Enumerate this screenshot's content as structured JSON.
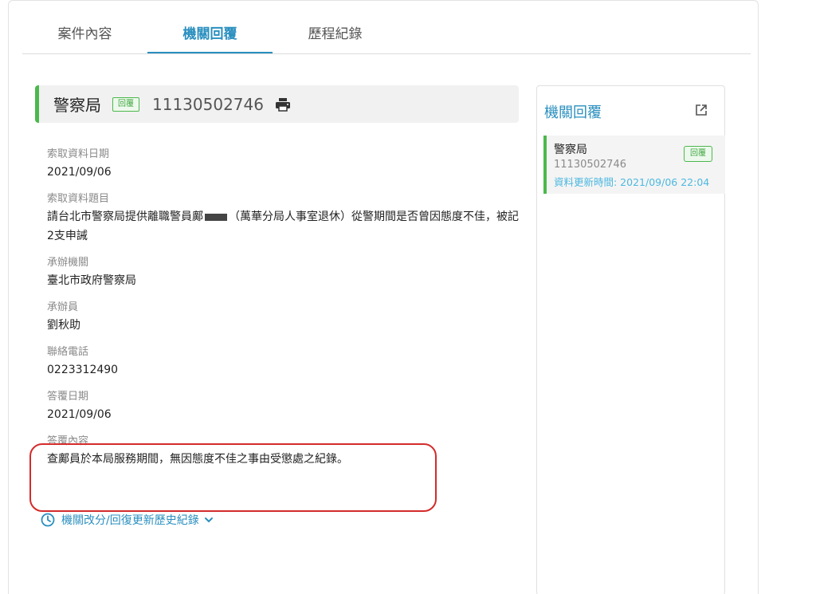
{
  "tabs": [
    {
      "label": "案件內容"
    },
    {
      "label": "機關回覆"
    },
    {
      "label": "歷程紀錄"
    }
  ],
  "active_tab": "機關回覆",
  "agency": {
    "name": "警察局",
    "badge": "回覆",
    "case_number": "11130502746",
    "print_icon": "printer-icon"
  },
  "fields": [
    {
      "label": "索取資料日期",
      "value": "2021/09/06"
    },
    {
      "label": "索取資料題目",
      "value_before": "請台北市警察局提供離職警員鄺",
      "value_after": "（萬華分局人事室退休）從警期間是否曾因態度不佳，被記2支申誡"
    },
    {
      "label": "承辦機關",
      "value": "臺北市政府警察局"
    },
    {
      "label": "承辦員",
      "value": "劉秋助"
    },
    {
      "label": "聯絡電話",
      "value": "0223312490"
    },
    {
      "label": "答覆日期",
      "value": "2021/09/06"
    },
    {
      "label": "答覆內容",
      "value": "查鄺員於本局服務期間，無因態度不佳之事由受懲處之紀錄。"
    }
  ],
  "history_link": {
    "label": "機關改分/回復更新歷史紀錄",
    "icon": "clock-icon",
    "chevron": "chevron-down-icon"
  },
  "side_panel": {
    "title": "機關回覆",
    "icon": "external-link-icon",
    "items": [
      {
        "name": "警察局",
        "case_number": "11130502746",
        "updated": "資料更新時間: 2021/09/06 22:04",
        "badge": "回覆"
      }
    ]
  },
  "colors": {
    "accent": "#2a8fbf",
    "green": "#4cb84c",
    "highlight_red": "#d42b2b",
    "timestamp": "#4db8e0"
  }
}
